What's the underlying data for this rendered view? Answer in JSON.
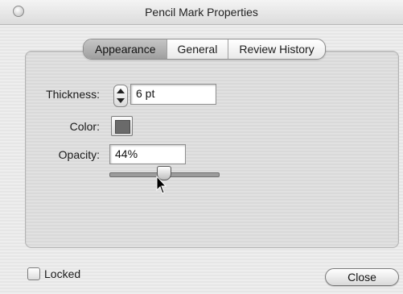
{
  "window": {
    "title": "Pencil Mark Properties"
  },
  "tabs": [
    {
      "label": "Appearance",
      "selected": true
    },
    {
      "label": "General",
      "selected": false
    },
    {
      "label": "Review History",
      "selected": false
    }
  ],
  "appearance": {
    "thickness": {
      "label": "Thickness:",
      "value": "6 pt"
    },
    "color": {
      "label": "Color:",
      "swatch": "#6a6a6a"
    },
    "opacity": {
      "label": "Opacity:",
      "value": "44%",
      "slider_fraction": 0.44
    }
  },
  "footer": {
    "locked_label": "Locked",
    "locked_checked": false,
    "close_label": "Close"
  }
}
